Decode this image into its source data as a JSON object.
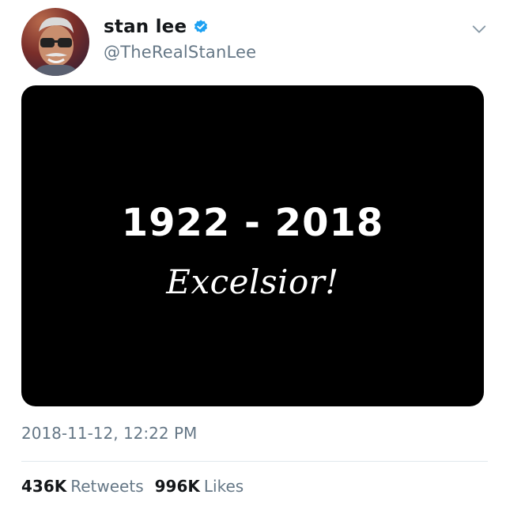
{
  "user": {
    "display_name": "stan lee",
    "handle": "@TheRealStanLee",
    "verified": true
  },
  "media": {
    "years": "1922 - 2018",
    "motto": "Excelsior!"
  },
  "timestamp": "2018-11-12, 12:22 PM",
  "stats": {
    "retweets_count": "436K",
    "retweets_label": "Retweets",
    "likes_count": "996K",
    "likes_label": "Likes"
  },
  "icons": {
    "verified": "verified-badge-icon",
    "menu": "chevron-down-icon"
  },
  "colors": {
    "verified_blue": "#1da1f2",
    "secondary_text": "#657786",
    "primary_text": "#14171a",
    "media_background": "#000000"
  }
}
